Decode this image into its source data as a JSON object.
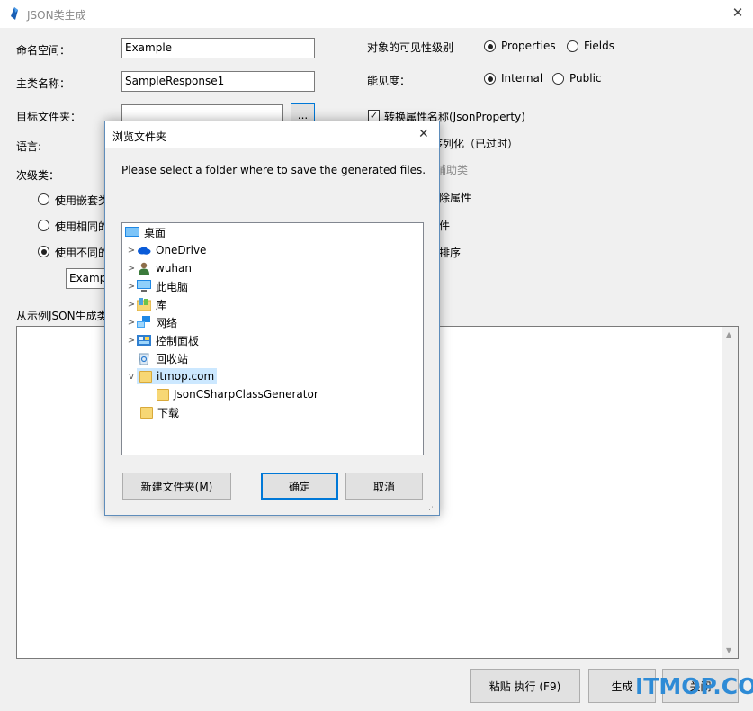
{
  "window": {
    "title": "JSON类生成",
    "close_glyph": "✕"
  },
  "form": {
    "namespace_label": "命名空间：",
    "namespace_value": "Example",
    "main_class_label": "主类名称：",
    "main_class_value": "SampleResponse1",
    "target_folder_label": "目标文件夹：",
    "target_folder_value": "",
    "browse_button": "...",
    "language_label": "语言:",
    "secondary_label": "次级类：",
    "secondary_options": [
      "使用嵌套类",
      "使用相同的",
      "使用不同的"
    ],
    "secondary_namespace_value": "Examp",
    "json_sample_label": "从示例JSON生成类"
  },
  "right_panel": {
    "visibility_label": "对象的可见性级别",
    "visibility_options": [
      "Properties",
      "Fields"
    ],
    "access_label": "能见度：",
    "access_options": [
      "Internal",
      "Public"
    ],
    "checks": [
      {
        "label": "转换属性名称(JsonProperty)",
        "checked": true
      },
      {
        "label": "序列化（已过时）",
        "checked": false
      },
      {
        "label": "辅助类",
        "checked": false,
        "disabled": true
      },
      {
        "label": "除属性",
        "checked": false
      },
      {
        "label": "件",
        "checked": false
      },
      {
        "label": "排序",
        "checked": false
      }
    ]
  },
  "bottom_buttons": {
    "paste_run": "粘贴  执行 (F9)",
    "generate": "生成",
    "close": "关闭"
  },
  "dialog": {
    "title": "浏览文件夹",
    "close_glyph": "✕",
    "prompt": "Please select a folder where to save the generated files.",
    "tree": [
      {
        "label": "桌面",
        "icon": "desktop-icon",
        "level": 0,
        "expander": ""
      },
      {
        "label": "OneDrive",
        "icon": "cloud-icon",
        "level": 1,
        "expander": ">"
      },
      {
        "label": "wuhan",
        "icon": "user-icon",
        "level": 1,
        "expander": ">"
      },
      {
        "label": "此电脑",
        "icon": "computer-icon",
        "level": 1,
        "expander": ">"
      },
      {
        "label": "库",
        "icon": "library-icon",
        "level": 1,
        "expander": ">"
      },
      {
        "label": "网络",
        "icon": "network-icon",
        "level": 1,
        "expander": ">"
      },
      {
        "label": "控制面板",
        "icon": "control-panel-icon",
        "level": 1,
        "expander": ">"
      },
      {
        "label": "回收站",
        "icon": "recycle-bin-icon",
        "level": 1,
        "expander": ""
      },
      {
        "label": "itmop.com",
        "icon": "folder-icon",
        "level": 1,
        "expander": "v",
        "selected": true
      },
      {
        "label": "JsonCSharpClassGenerator",
        "icon": "folder-icon",
        "level": 2,
        "expander": ""
      },
      {
        "label": "下载",
        "icon": "folder-icon",
        "level": 1,
        "expander": ""
      }
    ],
    "new_folder_button": "新建文件夹(M)",
    "ok_button": "确定",
    "cancel_button": "取消"
  },
  "watermark": "ITMOP.COM",
  "colors": {
    "accent": "#0078d7",
    "selection": "#cce8ff",
    "folder": "#f7d775",
    "watermark": "#2e8bd6"
  }
}
